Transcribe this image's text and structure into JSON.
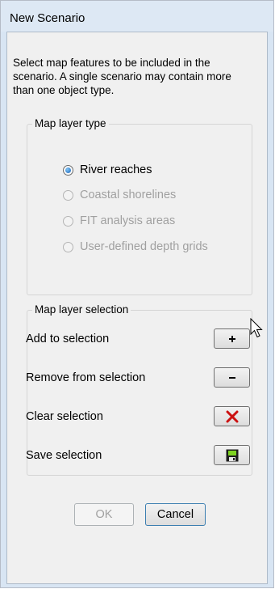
{
  "window": {
    "title": "New Scenario"
  },
  "description": "Select map features to be included in the scenario.  A single scenario may contain more than one object type.",
  "layer_type": {
    "label": "Map layer type",
    "options": [
      {
        "label": "River reaches",
        "checked": true,
        "enabled": true
      },
      {
        "label": "Coastal shorelines",
        "checked": false,
        "enabled": false
      },
      {
        "label": "FIT analysis areas",
        "checked": false,
        "enabled": false
      },
      {
        "label": "User-defined depth grids",
        "checked": false,
        "enabled": false
      }
    ]
  },
  "layer_selection": {
    "label": "Map layer selection",
    "rows": [
      {
        "label": "Add to selection",
        "icon": "plus-icon"
      },
      {
        "label": "Remove from selection",
        "icon": "minus-icon"
      },
      {
        "label": "Clear selection",
        "icon": "red-x-icon"
      },
      {
        "label": "Save selection",
        "icon": "floppy-disk-icon"
      }
    ]
  },
  "buttons": {
    "ok": "OK",
    "cancel": "Cancel",
    "ok_enabled": false
  },
  "colors": {
    "title_bar": "#dde8f4",
    "client": "#f0f0f0",
    "clear_x": "#cc1111",
    "radio_checked": "#1b63b8"
  },
  "cursor": "arrow-cursor-icon"
}
